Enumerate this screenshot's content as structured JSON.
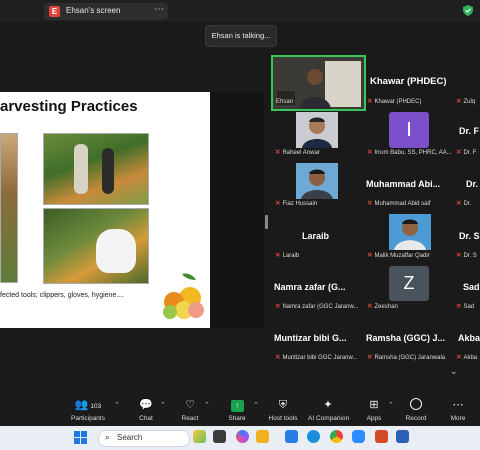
{
  "topbar": {
    "screen_owner": "Ehsan's screen",
    "owner_initial": "E",
    "menu": "⋯",
    "talking": "Ehsan is talking..."
  },
  "slide": {
    "title": "arvesting Practices",
    "caption": "fected tools; clippers, gloves, hygiene...."
  },
  "gallery": {
    "speaker": {
      "name": "Ehsan"
    },
    "tiles": [
      {
        "name": "Khawar (PHDEC)",
        "sub": "Khawar (PHDEC)"
      },
      {
        "name": "Zulq",
        "sub": "Zulq"
      },
      {
        "name": "",
        "sub": "Raheel Anwar"
      },
      {
        "name": "I",
        "sub": "Irrum Babu, SS, PHRC, AA..."
      },
      {
        "name": "Dr. F",
        "sub": "Dr. F"
      },
      {
        "name": "",
        "sub": "Fiaz Hussain"
      },
      {
        "name": "Muhammad Abi...",
        "sub": "Muhammad Abid saif"
      },
      {
        "name": "Dr.",
        "sub": "Dr."
      },
      {
        "name": "Laraib",
        "sub": "Laraib"
      },
      {
        "name": "",
        "sub": "Malik Muzaffar Qadir"
      },
      {
        "name": "Dr. S",
        "sub": "Dr. S"
      },
      {
        "name": "Namra zafar (G...",
        "sub": "Namra zafar (GGC Jaranw..."
      },
      {
        "name": "Z",
        "sub": "Zeeshan"
      },
      {
        "name": "Sad",
        "sub": "Sad"
      },
      {
        "name": "Muntizar bibi G...",
        "sub": "Muntizar bibi GGC Jaranw..."
      },
      {
        "name": "Ramsha (GGC) J...",
        "sub": "Ramsha (GGC) Jaranwala"
      },
      {
        "name": "Akba",
        "sub": "Akba"
      }
    ],
    "scroll": "⌄"
  },
  "toolbar": {
    "participants_count": "103",
    "items": [
      "Participants",
      "Chat",
      "React",
      "Share",
      "Host tools",
      "AI Companion",
      "Apps",
      "Record",
      "More"
    ]
  },
  "taskbar": {
    "search": "Search"
  },
  "colors": {
    "speaking_border": "#39c55a",
    "muted_mic": "#e0453b",
    "share_green": "#1aa34a",
    "avatar_purple": "#7b4fc9"
  }
}
